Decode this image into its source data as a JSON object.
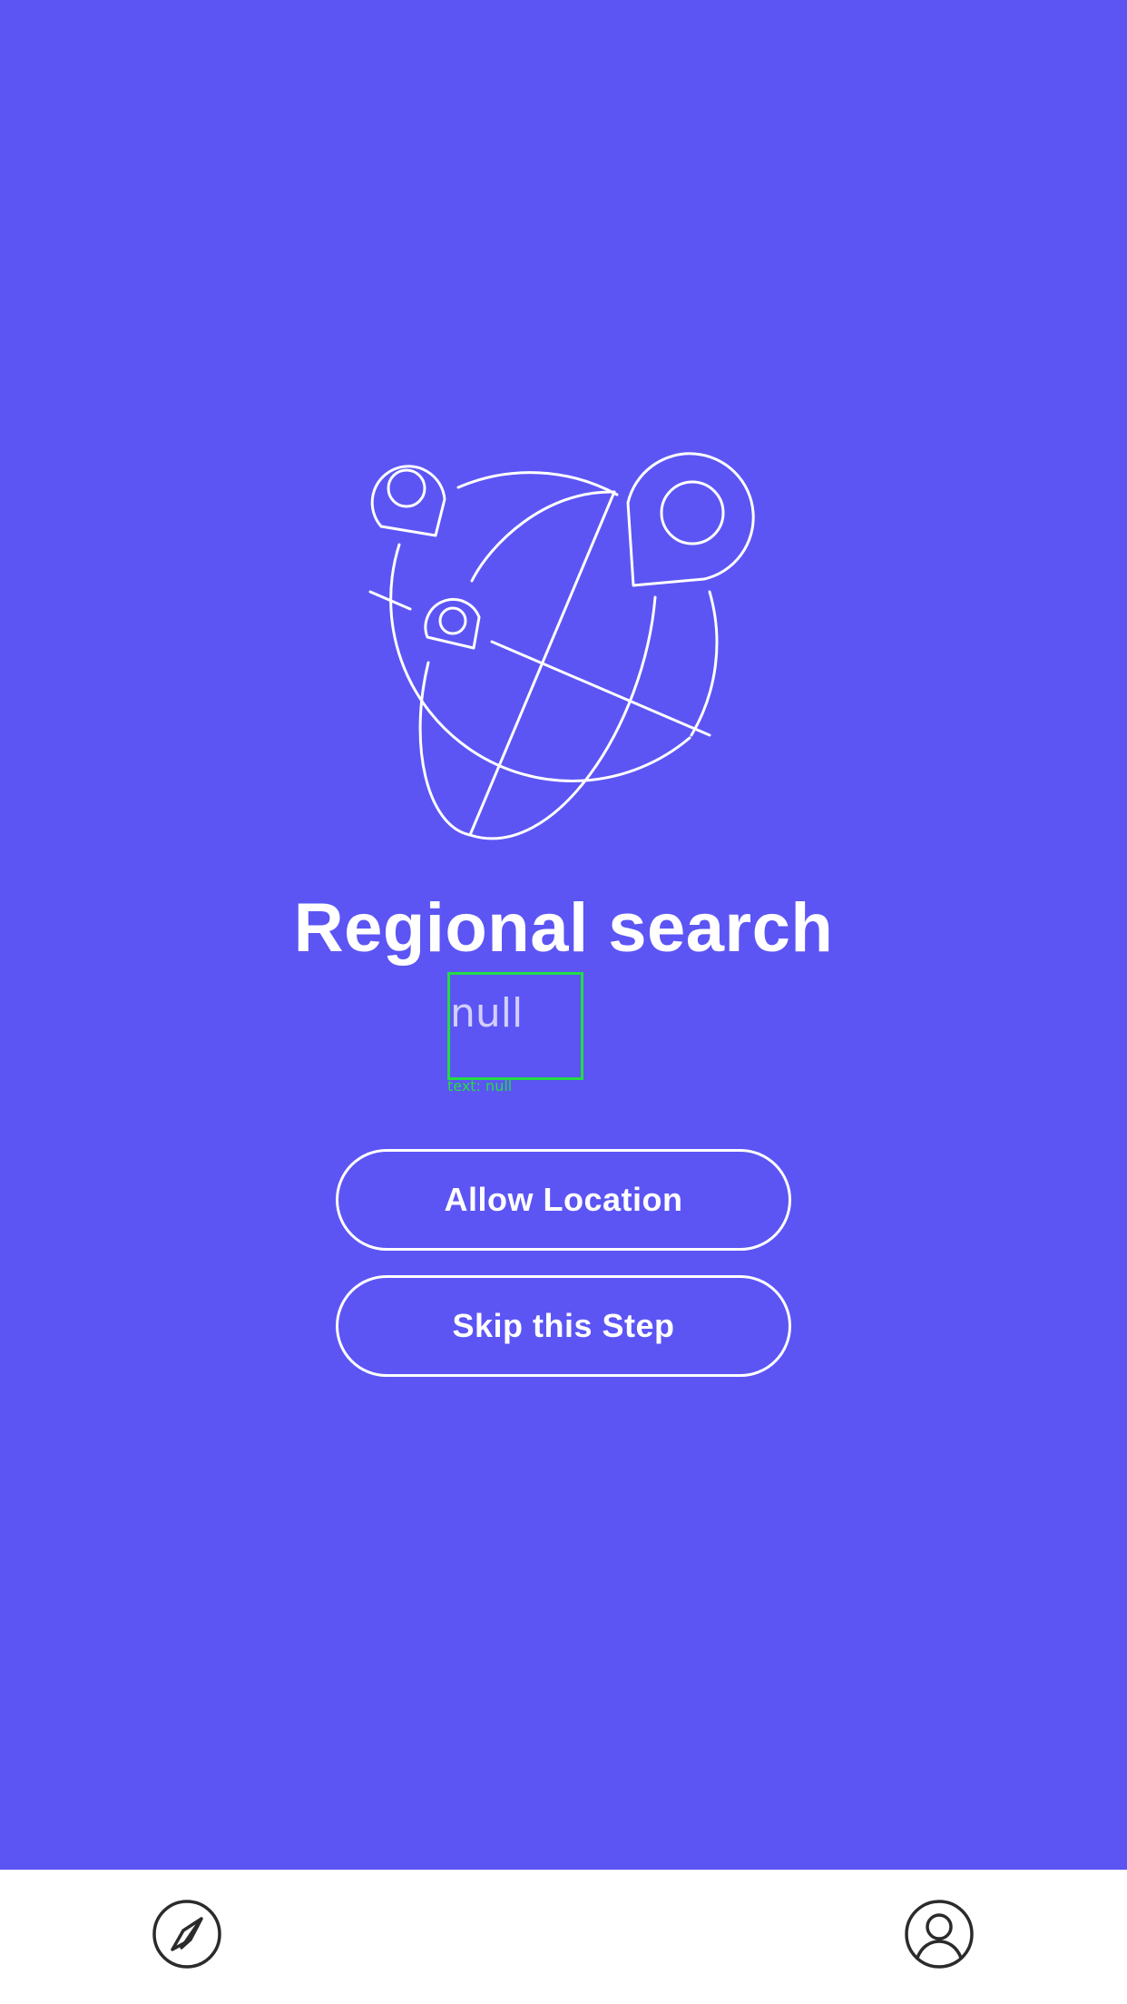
{
  "screen": {
    "background_color": "#5c55f4",
    "accent_color": "#ffffff",
    "illustration": "globe-with-location-pins-icon"
  },
  "onboarding": {
    "title": "Regional search",
    "subtitle": "null",
    "debug_label": "text: null"
  },
  "actions": {
    "allow_label": "Allow Location",
    "skip_label": "Skip this Step"
  },
  "tabbar": {
    "items": [
      {
        "icon": "compass-icon"
      },
      {
        "icon": "user-profile-icon"
      }
    ]
  }
}
